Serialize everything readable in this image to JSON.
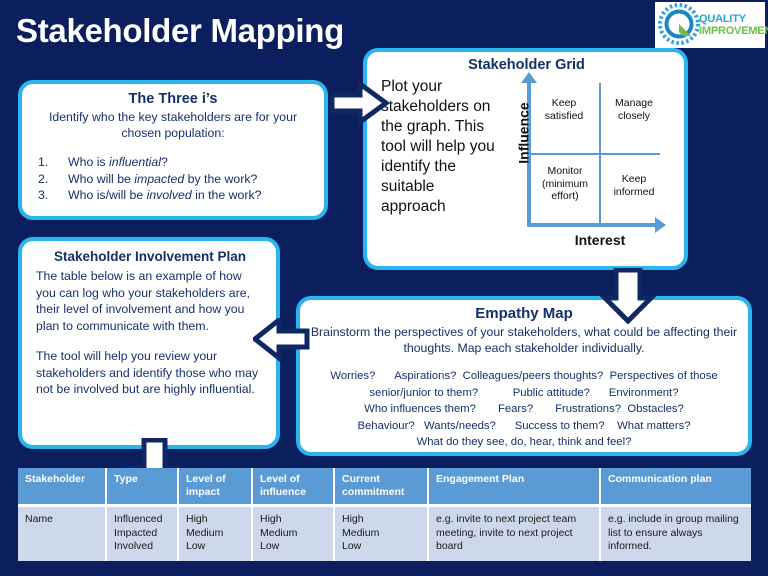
{
  "page": {
    "title": "Stakeholder Mapping",
    "background_color": "#0b1f5e",
    "accent_cyan": "#29b6ef",
    "accent_blue": "#5b9bd5",
    "text_navy": "#16306c"
  },
  "logo": {
    "name": "quality-improvement-logo",
    "word1": "QUALITY",
    "word2": "IMPROVEMENT",
    "letter": "Q",
    "color1": "#29a3dc",
    "color2": "#6cbf44"
  },
  "three_is": {
    "heading": "The Three i’s",
    "lead": "Identify who the key stakeholders are for your chosen population:",
    "items": [
      {
        "num": "1.",
        "pre": "Who is ",
        "em": "influential",
        "post": "?"
      },
      {
        "num": "2.",
        "pre": "Who will be ",
        "em": "impacted",
        "post": " by the work?"
      },
      {
        "num": "3.",
        "pre": "Who is/will be ",
        "em": "involved",
        "post": " in the work?"
      }
    ]
  },
  "stakeholder_grid": {
    "heading": "Stakeholder Grid",
    "body": "Plot your stakeholders on the graph. This tool will help you identify the suitable approach",
    "y_axis_label": "Influence",
    "x_axis_label": "Interest",
    "quadrants": {
      "top_left": "Keep satisfied",
      "top_right": "Manage closely",
      "bottom_left": "Monitor (minimum effort)",
      "bottom_right": "Keep informed"
    }
  },
  "involvement_plan": {
    "heading": "Stakeholder Involvement Plan",
    "paragraph1": "The table below is an example of how you can log who your stakeholders are, their level of involvement and how you plan to communicate with them.",
    "paragraph2": "The tool will help you review your stakeholders and identify those who may not be involved but are highly influential."
  },
  "empathy_map": {
    "heading": "Empathy Map",
    "subtitle": "Brainstorm the perspectives of your stakeholders, what could be affecting their thoughts. Map each stakeholder individually.",
    "prompt_lines": [
      [
        "Worries?",
        "Aspirations?",
        "Colleagues/peers thoughts?",
        "Perspectives of those"
      ],
      [
        "senior/junior to them?",
        "Public attitude?",
        "Environment?"
      ],
      [
        "Who influences them?",
        "Fears?",
        "Frustrations?",
        "Obstacles?"
      ],
      [
        "Behaviour?",
        "Wants/needs?",
        "Success to them?",
        "What matters?"
      ],
      [
        "What do they see, do, hear, think and feel?"
      ]
    ]
  },
  "arrows": [
    {
      "name": "arrow-three-is-to-grid",
      "direction": "right"
    },
    {
      "name": "arrow-grid-to-empathy-map",
      "direction": "down"
    },
    {
      "name": "arrow-empathy-map-to-involvement-plan",
      "direction": "left"
    },
    {
      "name": "arrow-involvement-plan-to-table",
      "direction": "down"
    }
  ],
  "table": {
    "columns": [
      "Stakeholder",
      "Type",
      "Level of impact",
      "Level of influence",
      "Current commitment",
      "Engagement Plan",
      "Communication plan"
    ],
    "rows": [
      [
        "Name",
        "Influenced\nImpacted\nInvolved",
        "High\nMedium\nLow",
        "High\nMedium\nLow",
        "High\nMedium\nLow",
        "e.g. invite to next project team meeting, invite to next project board",
        "e.g. include in group mailing list to ensure always informed."
      ]
    ]
  }
}
